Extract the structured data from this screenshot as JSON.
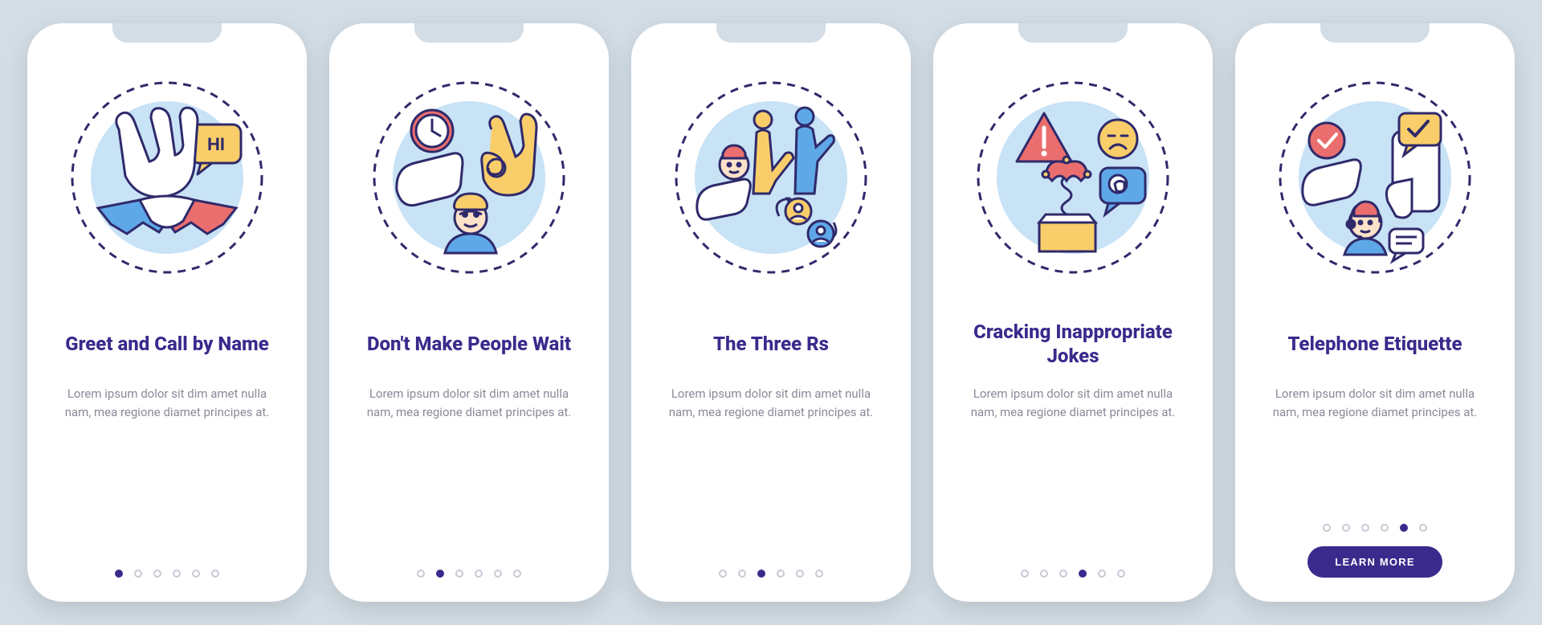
{
  "screens": [
    {
      "icon": "greet-handshake-icon",
      "title": "Greet and Call by Name",
      "desc": "Lorem ipsum dolor sit dim amet nulla nam, mea regione diamet principes at."
    },
    {
      "icon": "dont-wait-icon",
      "title": "Don't Make People Wait",
      "desc": "Lorem ipsum dolor sit dim amet nulla nam, mea regione diamet principes at."
    },
    {
      "icon": "three-rs-icon",
      "title": "The Three Rs",
      "desc": "Lorem ipsum dolor sit dim amet nulla nam, mea regione diamet principes at."
    },
    {
      "icon": "inappropriate-jokes-icon",
      "title": "Cracking Inappropriate Jokes",
      "desc": "Lorem ipsum dolor sit dim amet nulla nam, mea regione diamet principes at."
    },
    {
      "icon": "telephone-etiquette-icon",
      "title": "Telephone Etiquette",
      "desc": "Lorem ipsum dolor sit dim amet nulla nam, mea regione diamet principes at."
    }
  ],
  "pagination": {
    "total_dots": 6,
    "active_per_screen": [
      0,
      1,
      2,
      3,
      4
    ]
  },
  "cta": {
    "label": "LEARN MORE",
    "visible_on_screen": 4
  },
  "colors": {
    "background": "#d3dde5",
    "card": "#ffffff",
    "title": "#3a2a8c",
    "body_text": "#8a8a9a",
    "dot_inactive": "#c9c9d6",
    "dot_active": "#3a2a8c",
    "button_bg": "#3a2a8c",
    "illus_bg": "#c8e2f6",
    "illus_outline": "#2f2a6b",
    "illus_red": "#eb6e6e",
    "illus_yellow": "#f9ce6a",
    "illus_blue": "#5fa8e8"
  }
}
